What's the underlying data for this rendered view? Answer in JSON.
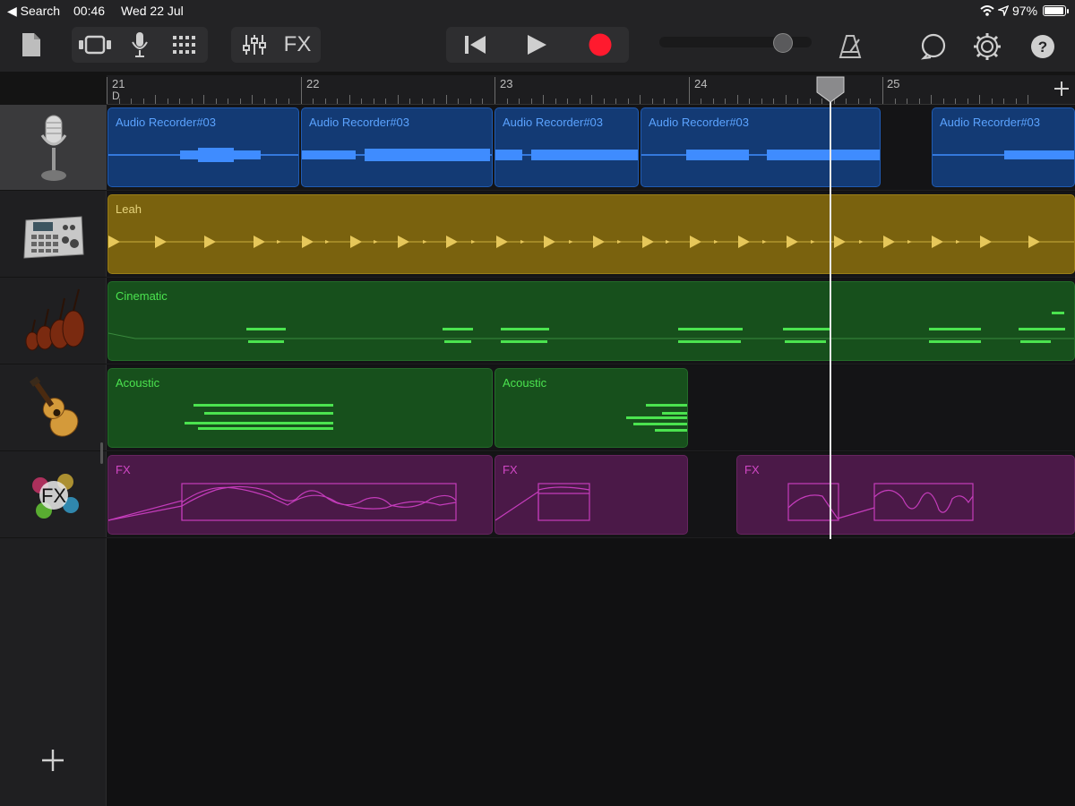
{
  "status": {
    "back_label": "◀ Search",
    "time": "00:46",
    "date": "Wed 22 Jul",
    "battery": "97%",
    "battery_level": 0.97
  },
  "toolbar": {
    "fx_label": "FX",
    "master_volume_level": 0.81
  },
  "ruler": {
    "bars": [
      "21",
      "22",
      "23",
      "24",
      "25"
    ],
    "section_marker": "D"
  },
  "tracks": [
    {
      "name": "Audio Recorder",
      "icon": "microphone-icon",
      "selected": true
    },
    {
      "name": "Drum Machine",
      "icon": "drum-machine-icon"
    },
    {
      "name": "Strings",
      "icon": "strings-icon"
    },
    {
      "name": "Acoustic Guitar",
      "icon": "acoustic-guitar-icon"
    },
    {
      "name": "FX",
      "icon": "fx-icon"
    }
  ],
  "regions": {
    "audio": [
      "Audio Recorder#03",
      "Audio Recorder#03",
      "Audio Recorder#03",
      "Audio Recorder#03",
      "Audio Recorder#03"
    ],
    "drum": [
      "Leah"
    ],
    "strings": [
      "Cinematic"
    ],
    "guitar": [
      "Acoustic",
      "Acoustic"
    ],
    "fx": [
      "FX",
      "FX",
      "FX"
    ]
  },
  "colors": {
    "audio": "#133a74",
    "drums": "#7a620e",
    "instrument": "#17501c",
    "fx": "#4b1948",
    "record": "#ff1a2e"
  }
}
